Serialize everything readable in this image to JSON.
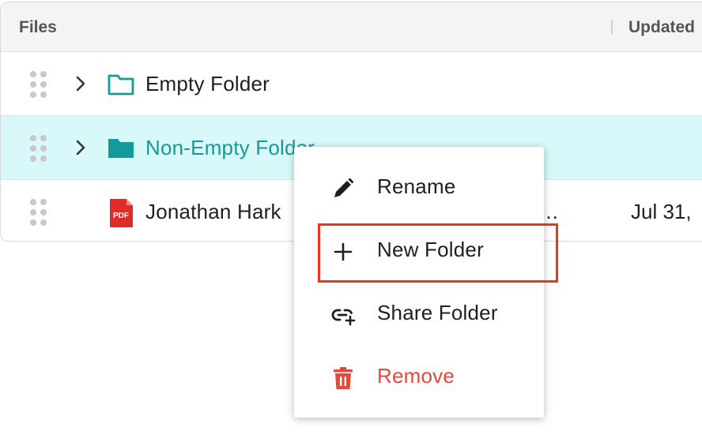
{
  "table": {
    "columns": {
      "files": "Files",
      "updated": "Updated"
    },
    "rows": [
      {
        "name": "Empty Folder",
        "type": "folder-empty",
        "truncated": "",
        "updated": ""
      },
      {
        "name": "Non-Empty Folder",
        "type": "folder-filled",
        "truncated": "",
        "updated": ""
      },
      {
        "name": "Jonathan Hark",
        "type": "pdf",
        "truncated": "…",
        "updated": "Jul 31,"
      }
    ]
  },
  "context_menu": {
    "items": [
      {
        "label": "Rename",
        "icon": "pencil-icon"
      },
      {
        "label": "New Folder",
        "icon": "plus-icon"
      },
      {
        "label": "Share Folder",
        "icon": "link-add-icon"
      },
      {
        "label": "Remove",
        "icon": "trash-icon"
      }
    ]
  },
  "colors": {
    "accent_teal": "#149a99",
    "selected_row": "#d8f8f9",
    "danger": "#e5483c",
    "pdf_red": "#e02b2b",
    "highlight_box": "#f0321a"
  }
}
